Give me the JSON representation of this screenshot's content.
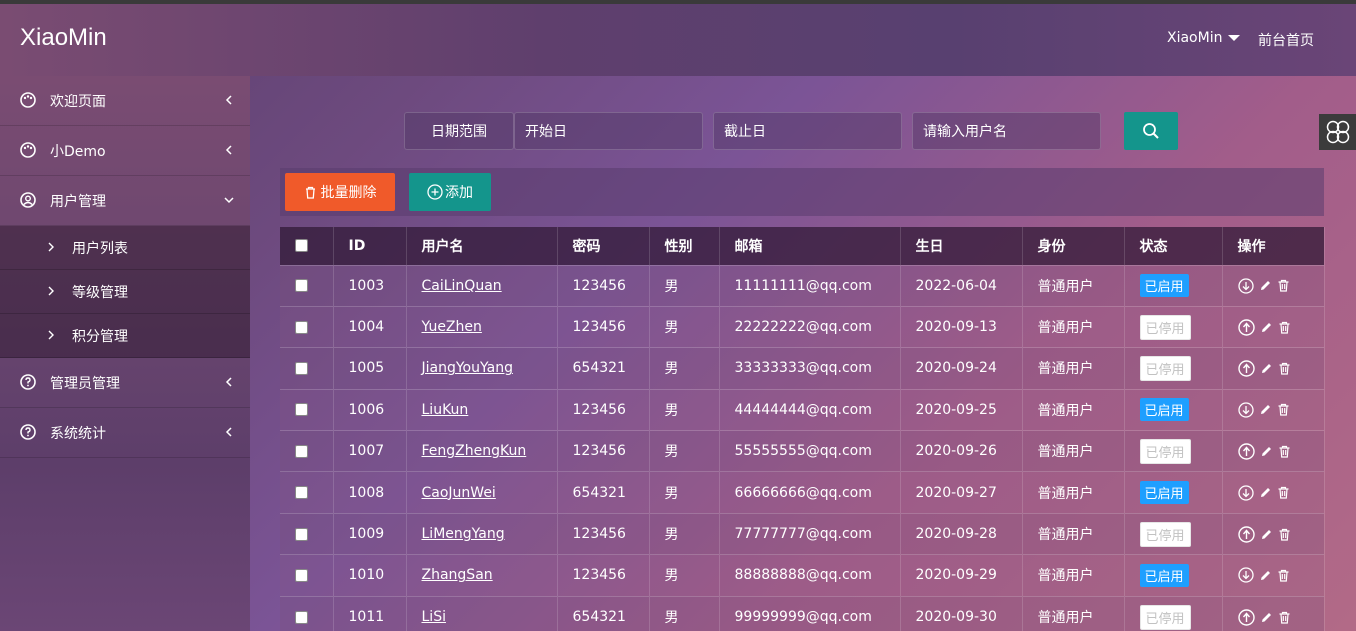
{
  "header": {
    "logo": "XiaoMin",
    "user": "XiaoMin",
    "front_link": "前台首页"
  },
  "sidebar": {
    "items": [
      {
        "label": "欢迎页面"
      },
      {
        "label": "小Demo"
      },
      {
        "label": "用户管理"
      },
      {
        "label": "管理员管理"
      },
      {
        "label": "系统统计"
      }
    ],
    "sub_items": [
      {
        "label": "用户列表"
      },
      {
        "label": "等级管理"
      },
      {
        "label": "积分管理"
      }
    ]
  },
  "search": {
    "date_label": "日期范围",
    "start_placeholder": "开始日",
    "end_placeholder": "截止日",
    "user_placeholder": "请输入用户名"
  },
  "toolbar": {
    "batch_delete": "批量删除",
    "add": "添加"
  },
  "table": {
    "headers": [
      "ID",
      "用户名",
      "密码",
      "性别",
      "邮箱",
      "生日",
      "身份",
      "状态",
      "操作"
    ],
    "rows": [
      {
        "id": "1003",
        "username": "CaiLinQuan",
        "password": "123456",
        "gender": "男",
        "email": "11111111@qq.com",
        "birthday": "2022-06-04",
        "role": "普通用户",
        "status": "已启用",
        "enabled": true
      },
      {
        "id": "1004",
        "username": "YueZhen",
        "password": "123456",
        "gender": "男",
        "email": "22222222@qq.com",
        "birthday": "2020-09-13",
        "role": "普通用户",
        "status": "已停用",
        "enabled": false
      },
      {
        "id": "1005",
        "username": "JiangYouYang",
        "password": "654321",
        "gender": "男",
        "email": "33333333@qq.com",
        "birthday": "2020-09-24",
        "role": "普通用户",
        "status": "已停用",
        "enabled": false
      },
      {
        "id": "1006",
        "username": "LiuKun",
        "password": "123456",
        "gender": "男",
        "email": "44444444@qq.com",
        "birthday": "2020-09-25",
        "role": "普通用户",
        "status": "已启用",
        "enabled": true
      },
      {
        "id": "1007",
        "username": "FengZhengKun",
        "password": "123456",
        "gender": "男",
        "email": "55555555@qq.com",
        "birthday": "2020-09-26",
        "role": "普通用户",
        "status": "已停用",
        "enabled": false
      },
      {
        "id": "1008",
        "username": "CaoJunWei",
        "password": "654321",
        "gender": "男",
        "email": "66666666@qq.com",
        "birthday": "2020-09-27",
        "role": "普通用户",
        "status": "已启用",
        "enabled": true
      },
      {
        "id": "1009",
        "username": "LiMengYang",
        "password": "123456",
        "gender": "男",
        "email": "77777777@qq.com",
        "birthday": "2020-09-28",
        "role": "普通用户",
        "status": "已停用",
        "enabled": false
      },
      {
        "id": "1010",
        "username": "ZhangSan",
        "password": "123456",
        "gender": "男",
        "email": "88888888@qq.com",
        "birthday": "2020-09-29",
        "role": "普通用户",
        "status": "已启用",
        "enabled": true
      },
      {
        "id": "1011",
        "username": "LiSi",
        "password": "654321",
        "gender": "男",
        "email": "99999999@qq.com",
        "birthday": "2020-09-30",
        "role": "普通用户",
        "status": "已停用",
        "enabled": false
      }
    ]
  },
  "colors": {
    "accent_teal": "#14958c",
    "danger": "#f05a2a",
    "status_on": "#1e9fff"
  }
}
